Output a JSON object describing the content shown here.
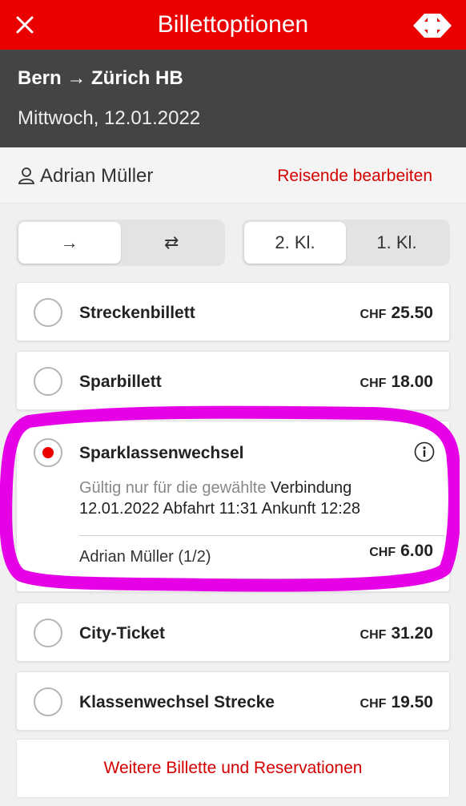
{
  "header": {
    "title": "Billettoptionen",
    "close_icon": "close-icon",
    "logo": "sbb-logo"
  },
  "route": {
    "title": "Bern → Zürich HB",
    "date": "Mittwoch, 12.01.2022"
  },
  "traveler": {
    "name": "Adrian Müller",
    "edit_label": "Reisende bearbeiten"
  },
  "direction_toggle": {
    "options": [
      "→",
      "⇄"
    ],
    "selected": 0
  },
  "class_toggle": {
    "options": [
      "2. Kl.",
      "1. Kl."
    ],
    "selected": 0
  },
  "options": [
    {
      "title": "Streckenbillett",
      "currency": "CHF",
      "amount": "25.50",
      "selected": false
    },
    {
      "title": "Sparbillett",
      "currency": "CHF",
      "amount": "18.00",
      "selected": false
    },
    {
      "title": "Sparklassenwechsel",
      "selected": true,
      "desc_muted": "Gültig nur für die gewählte",
      "desc_rest": " Verbindung",
      "desc_line2": "12.01.2022 Abfahrt 11:31 Ankunft 12:28",
      "person": "Adrian Müller (1/2)",
      "currency": "CHF",
      "amount": "6.00"
    },
    {
      "title": "City-Ticket",
      "currency": "CHF",
      "amount": "31.20",
      "selected": false
    },
    {
      "title": "Klassenwechsel Strecke",
      "currency": "CHF",
      "amount": "19.50",
      "selected": false
    }
  ],
  "more_button": "Weitere Billette und Reservationen",
  "colors": {
    "sbb_red": "#eb0000",
    "highlight": "#e600e6",
    "route_bg": "#444444"
  }
}
